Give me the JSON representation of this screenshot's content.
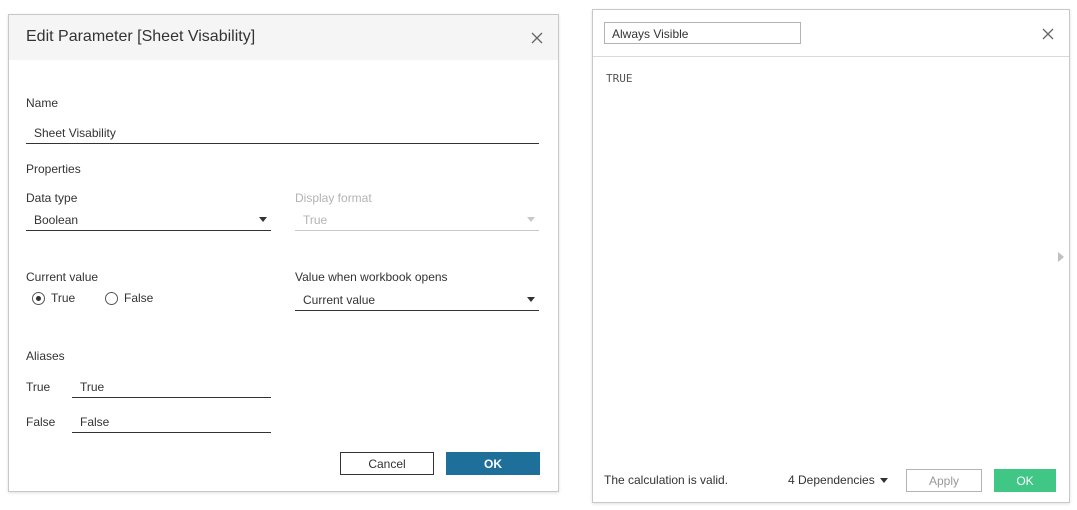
{
  "param_dialog": {
    "title": "Edit Parameter [Sheet Visability]",
    "name_label": "Name",
    "name_value": "Sheet Visability",
    "properties_label": "Properties",
    "data_type_label": "Data type",
    "data_type_value": "Boolean",
    "display_format_label": "Display format",
    "display_format_value": "True",
    "current_value_label": "Current value",
    "radio_true": "True",
    "radio_false": "False",
    "selected": "True",
    "workbook_opens_label": "Value when workbook opens",
    "workbook_opens_value": "Current value",
    "aliases_label": "Aliases",
    "alias_true_label": "True",
    "alias_true_value": "True",
    "alias_false_label": "False",
    "alias_false_value": "False",
    "cancel_label": "Cancel",
    "ok_label": "OK"
  },
  "calc_dialog": {
    "name_value": "Always Visible",
    "formula": "TRUE",
    "status": "The calculation is valid.",
    "dependencies_label": "4 Dependencies",
    "apply_label": "Apply",
    "ok_label": "OK"
  },
  "colors": {
    "ok_blue": "#1f6f9b",
    "ok_green": "#40c785"
  },
  "icons": {
    "close": "close-icon",
    "dropdown": "chevron-down-icon",
    "expand": "triangle-right-icon"
  }
}
